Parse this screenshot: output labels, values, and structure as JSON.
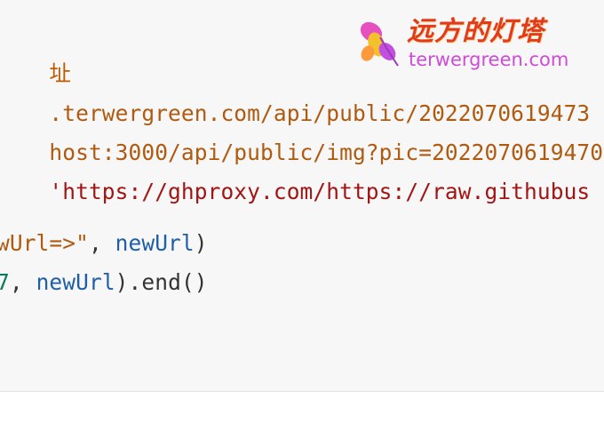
{
  "code": {
    "line1": {
      "comment": "址"
    },
    "line2": {
      "str": ".terwergreen.com/api/public/2022070619473"
    },
    "line3": {
      "str": "host:3000/api/public/img?pic=2022070619470"
    },
    "line4": {
      "str": "'https://ghproxy.com/https://raw.githubus"
    },
    "line6": {
      "str": "wUrl=>\"",
      "punc1": ", ",
      "var": "newUrl",
      "punc2": ")"
    },
    "line7": {
      "num": "7",
      "punc1": ", ",
      "var": "newUrl",
      "punc2": ").",
      "fn": "end",
      "punc3": "()"
    }
  },
  "watermark": {
    "cn_text": "远方的灯塔",
    "en_text": "terwergreen.com",
    "icon": "butterfly-icon"
  },
  "colors": {
    "panel_bg": "#f7f7f7",
    "comment": "#c05a00",
    "string": "#a31515",
    "variable": "#1f5fa8",
    "number": "#0a7a5c",
    "watermark_cn": "#e23b1a",
    "watermark_en": "#d04ad8"
  }
}
